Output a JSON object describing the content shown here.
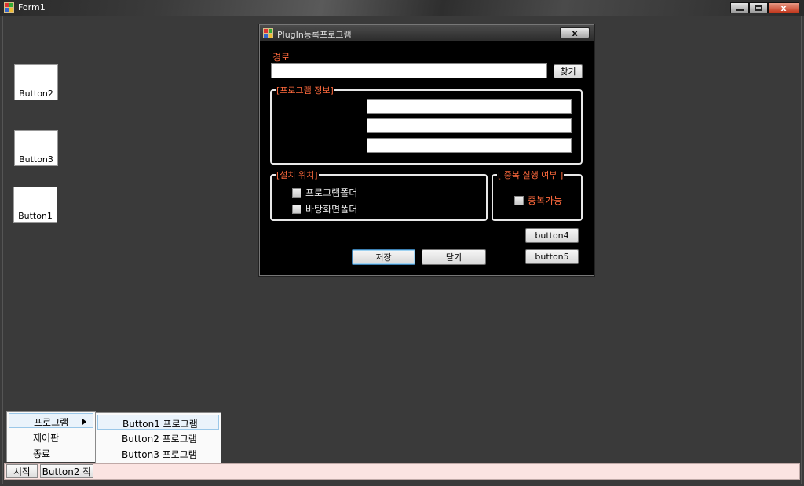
{
  "window": {
    "title": "Form1",
    "close_glyph": "x"
  },
  "side_buttons": [
    {
      "label": "Button2"
    },
    {
      "label": "Button3"
    },
    {
      "label": "Button1"
    }
  ],
  "dialog": {
    "title": "PlugIn등록프로그램",
    "close_glyph": "x",
    "path_label": "경로",
    "path_value": "",
    "browse_label": "찾기",
    "program_info_title": "[프로그램 정보]",
    "program_info_fields": [
      "",
      "",
      ""
    ],
    "install_location_title": "[설치 위치]",
    "install_options": [
      {
        "label": "프로그램폴더",
        "checked": false
      },
      {
        "label": "바탕화면폴더",
        "checked": false
      }
    ],
    "duplicate_title": "[ 중복 실행 여부 ]",
    "duplicate_option": {
      "label": "중복가능",
      "checked": false
    },
    "save_label": "저장",
    "close_label": "닫기",
    "button4_label": "button4",
    "button5_label": "button5"
  },
  "context_menu": {
    "items": [
      "프로그램",
      "제어판",
      "종료"
    ],
    "submenu": [
      "Button1 프로그램",
      "Button2 프로그램",
      "Button3 프로그램"
    ]
  },
  "taskbar": {
    "start_label": "시작",
    "task_label": "Button2 작"
  },
  "colors": {
    "accent_orange": "#ff6a3d",
    "background": "#3a3a3a",
    "dialog_bg": "#000000"
  }
}
